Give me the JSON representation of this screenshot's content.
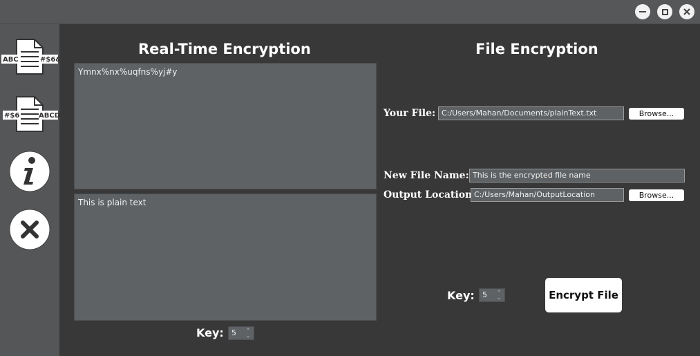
{
  "window": {
    "minimize_icon": "minimize-icon",
    "maximize_icon": "maximize-icon",
    "close_icon": "close-icon"
  },
  "sidebar": {
    "items": [
      {
        "icon": "encrypt-document-icon",
        "left_text": "ABC",
        "right_text": "#$6&"
      },
      {
        "icon": "decrypt-document-icon",
        "left_text": "#$6",
        "right_text": "ABCD"
      },
      {
        "icon": "info-icon"
      },
      {
        "icon": "exit-icon"
      }
    ]
  },
  "realtime": {
    "title": "Real-Time Encryption",
    "cipher_text": "Ymnx%nx%uqfns%yj#y",
    "plain_text": "This is plain text",
    "key_label": "Key:",
    "key_value": "5"
  },
  "file": {
    "title": "File Encryption",
    "your_file_label": "Your File:",
    "your_file_value": "C:/Users/Mahan/Documents/plainText.txt",
    "browse_label": "Browse...",
    "new_name_label": "New File Name:",
    "new_name_value": "This is the encrypted file name",
    "output_label": "Output Location",
    "output_value": "C:/Users/Mahan/OutputLocation",
    "browse2_label": "Browse...",
    "key_label": "Key:",
    "key_value": "5",
    "encrypt_button": "Encrypt File"
  },
  "colors": {
    "sidebar": "#545658",
    "main": "#383838",
    "textbox": "#5f6265",
    "accent": "#ffffff"
  }
}
